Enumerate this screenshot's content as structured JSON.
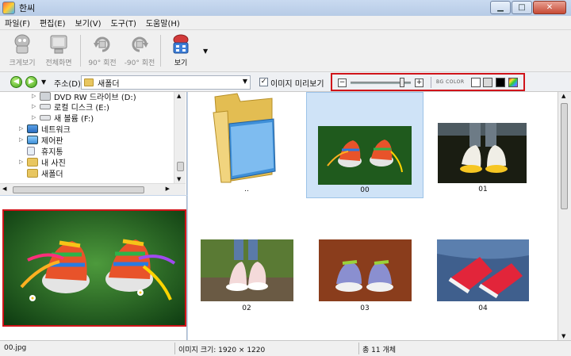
{
  "window": {
    "title": "한씨"
  },
  "menu": [
    "파일(F)",
    "편집(E)",
    "보기(V)",
    "도구(T)",
    "도움말(H)"
  ],
  "toolbar": {
    "items": [
      {
        "label": "크게보기",
        "icon": "magnify-view-icon",
        "enabled": false
      },
      {
        "label": "전체화면",
        "icon": "fullscreen-icon",
        "enabled": false
      },
      {
        "label": "90° 회전",
        "icon": "rotate-cw-icon",
        "enabled": false
      },
      {
        "label": "-90° 회전",
        "icon": "rotate-ccw-icon",
        "enabled": false
      },
      {
        "label": "보기",
        "icon": "view-mode-icon",
        "enabled": true
      }
    ]
  },
  "address": {
    "label": "주소(D)",
    "value": "새폴더",
    "preview_label": "이미지 미리보기",
    "preview_checked": true,
    "zoom_slider_level": 0.85,
    "color_label": "BG COLOR",
    "swatches": [
      "#ffffff",
      "#d9d9d9",
      "#000000",
      "multicolor"
    ]
  },
  "tree": [
    {
      "label": "DVD RW 드라이브 (D:)",
      "icon": "dvd-drive-icon",
      "expandable": true
    },
    {
      "label": "로컬 디스크 (E:)",
      "icon": "hard-disk-icon",
      "expandable": true
    },
    {
      "label": "새 볼륨 (F:)",
      "icon": "hard-disk-icon",
      "expandable": true
    },
    {
      "label": "네트워크",
      "icon": "network-icon",
      "expandable": true
    },
    {
      "label": "제어판",
      "icon": "control-panel-icon",
      "expandable": true
    },
    {
      "label": "휴지통",
      "icon": "recycle-bin-icon",
      "expandable": false
    },
    {
      "label": "내 사진",
      "icon": "folder-icon",
      "expandable": true
    },
    {
      "label": "새폴더",
      "icon": "folder-icon",
      "expandable": false
    }
  ],
  "thumbnails": [
    {
      "label": "..",
      "kind": "folder"
    },
    {
      "label": "00",
      "kind": "image",
      "selected": true
    },
    {
      "label": "01",
      "kind": "image"
    },
    {
      "label": "02",
      "kind": "image"
    },
    {
      "label": "03",
      "kind": "image"
    },
    {
      "label": "04",
      "kind": "image"
    }
  ],
  "status": {
    "file": "00.jpg",
    "size": "이미지 크기: 1920 × 1220",
    "count": "총 11 개체"
  }
}
